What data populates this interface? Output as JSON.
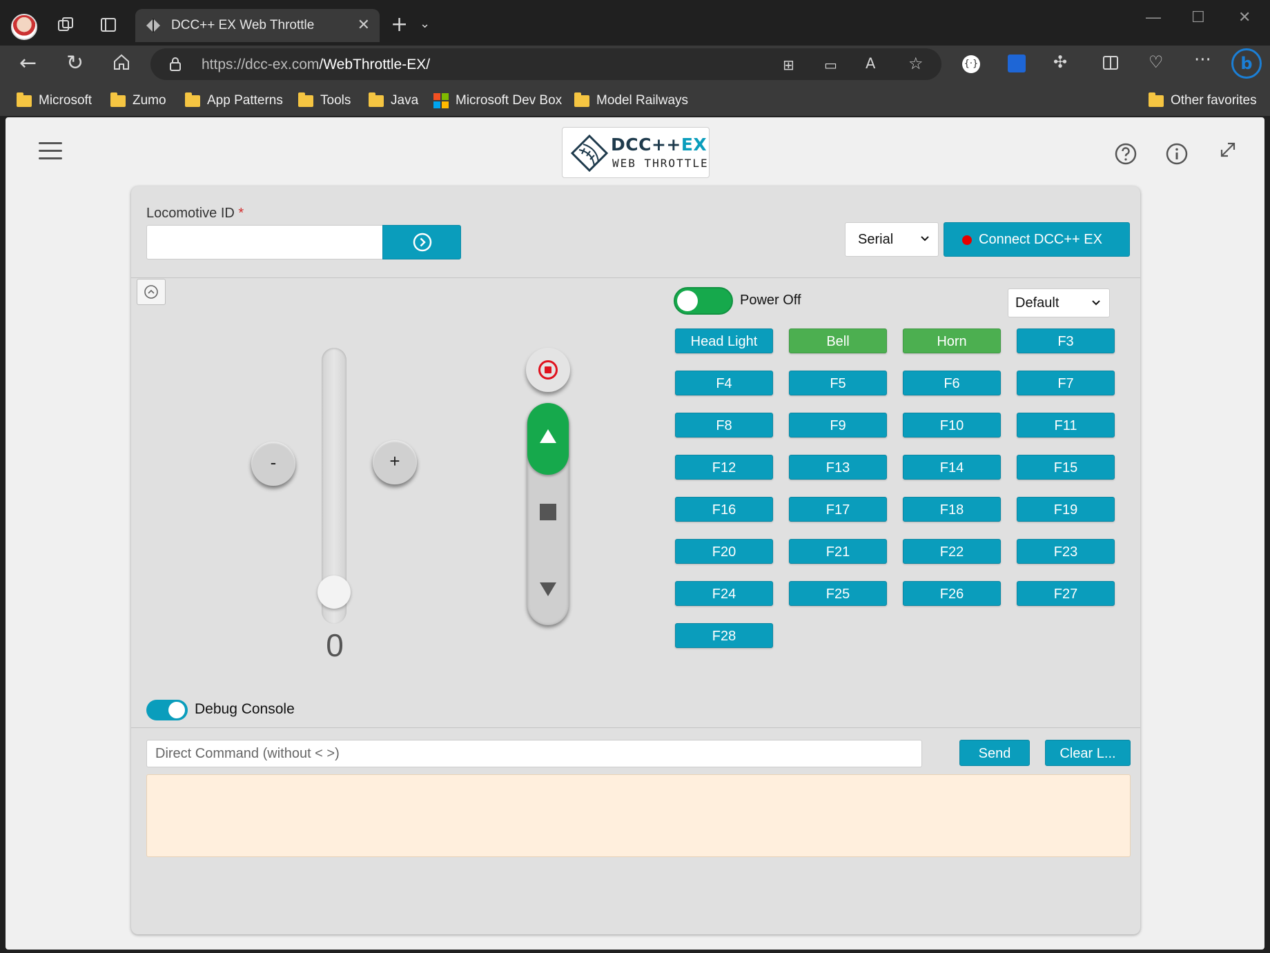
{
  "browser": {
    "tab_title": "DCC++ EX Web Throttle",
    "url_host": "https://dcc-ex.com",
    "url_path": "/WebThrottle-EX/",
    "favorites": [
      {
        "label": "Microsoft",
        "icon": "folder-icon"
      },
      {
        "label": "Zumo",
        "icon": "folder-icon"
      },
      {
        "label": "App Patterns",
        "icon": "folder-icon"
      },
      {
        "label": "Tools",
        "icon": "folder-icon"
      },
      {
        "label": "Java",
        "icon": "folder-icon"
      },
      {
        "label": "Microsoft Dev Box",
        "icon": "microsoft-logo-icon"
      },
      {
        "label": "Model Railways",
        "icon": "folder-icon"
      }
    ],
    "other_favorites": "Other favorites"
  },
  "header": {
    "logo_title_a": "DCC++",
    "logo_title_b": "EX",
    "logo_subtitle": "WEB THROTTLE",
    "icons": [
      "hamburger-menu-icon",
      "help-icon",
      "info-icon",
      "fullscreen-icon"
    ]
  },
  "connection": {
    "loco_label": "Locomotive ID",
    "required_mark": "*",
    "loco_value": "",
    "port_type": "Serial",
    "connect_label": "Connect DCC++ EX",
    "status_color": "#e60000"
  },
  "throttle": {
    "speed": "0",
    "speed_fraction": 0,
    "minus_label": "-",
    "plus_label": "+",
    "direction": "forward"
  },
  "power": {
    "label": "Power Off",
    "map_select": "Default"
  },
  "functions": [
    {
      "label": "Head Light",
      "on": false
    },
    {
      "label": "Bell",
      "on": true
    },
    {
      "label": "Horn",
      "on": true
    },
    {
      "label": "F3",
      "on": false
    },
    {
      "label": "F4",
      "on": false
    },
    {
      "label": "F5",
      "on": false
    },
    {
      "label": "F6",
      "on": false
    },
    {
      "label": "F7",
      "on": false
    },
    {
      "label": "F8",
      "on": false
    },
    {
      "label": "F9",
      "on": false
    },
    {
      "label": "F10",
      "on": false
    },
    {
      "label": "F11",
      "on": false
    },
    {
      "label": "F12",
      "on": false
    },
    {
      "label": "F13",
      "on": false
    },
    {
      "label": "F14",
      "on": false
    },
    {
      "label": "F15",
      "on": false
    },
    {
      "label": "F16",
      "on": false
    },
    {
      "label": "F17",
      "on": false
    },
    {
      "label": "F18",
      "on": false
    },
    {
      "label": "F19",
      "on": false
    },
    {
      "label": "F20",
      "on": false
    },
    {
      "label": "F21",
      "on": false
    },
    {
      "label": "F22",
      "on": false
    },
    {
      "label": "F23",
      "on": false
    },
    {
      "label": "F24",
      "on": false
    },
    {
      "label": "F25",
      "on": false
    },
    {
      "label": "F26",
      "on": false
    },
    {
      "label": "F27",
      "on": false
    },
    {
      "label": "F28",
      "on": false
    }
  ],
  "debug": {
    "label": "Debug Console",
    "command_placeholder": "Direct Command (without < >)",
    "send_label": "Send",
    "clear_label": "Clear L..."
  },
  "colors": {
    "accent": "#0a9dbc",
    "function_on": "#4caf50",
    "direction_forward": "#16a94c",
    "log_background": "#ffefdd"
  }
}
